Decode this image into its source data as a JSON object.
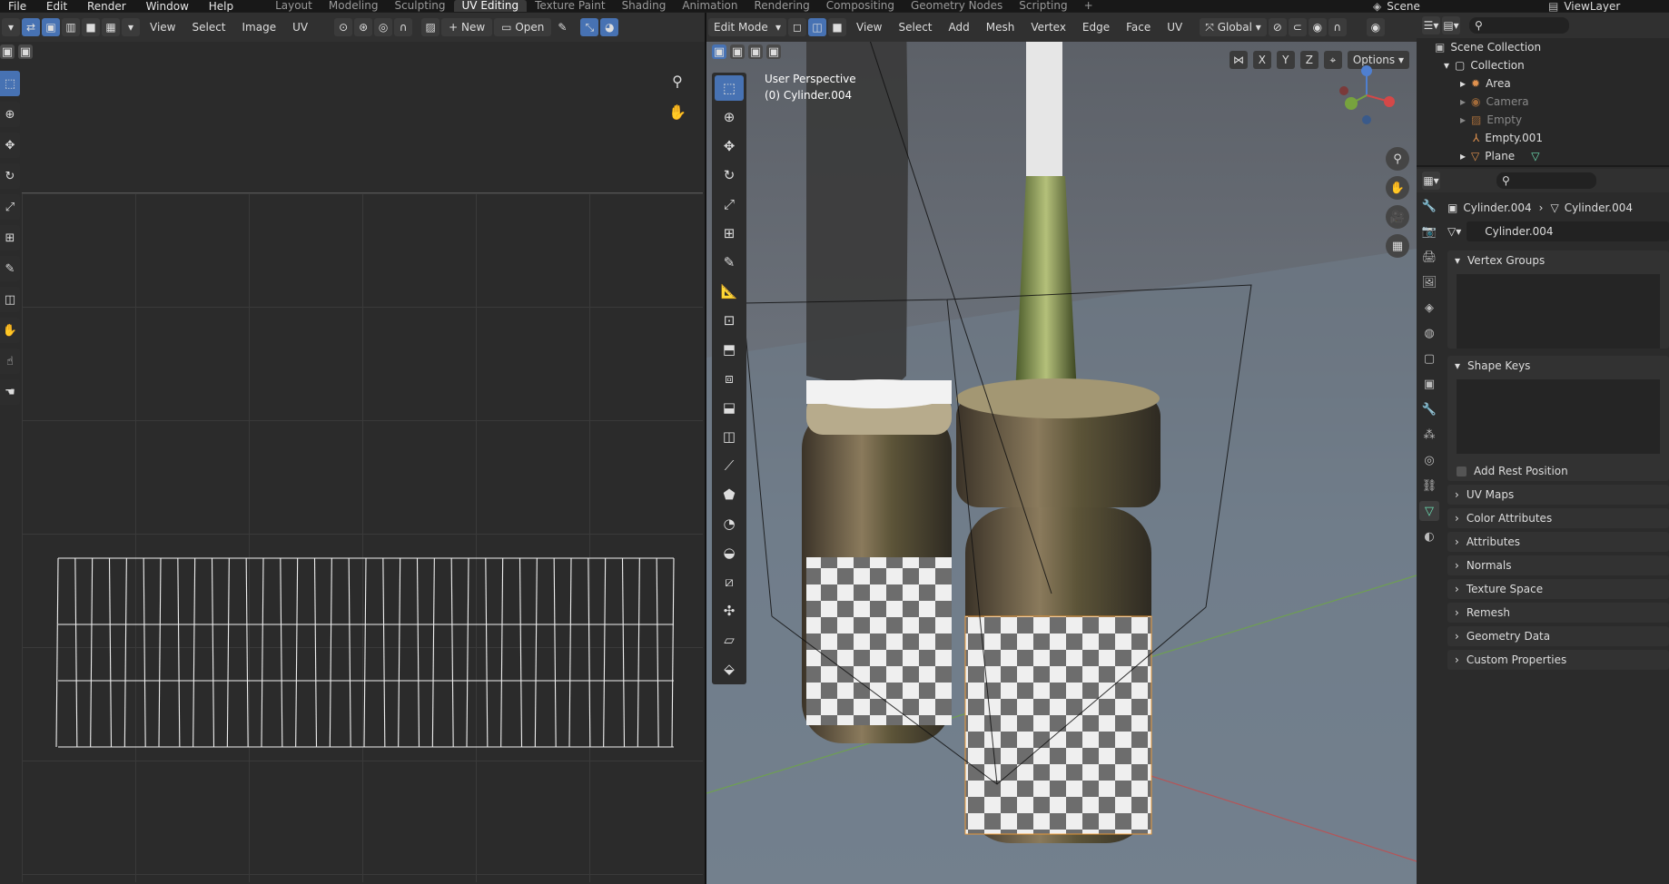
{
  "menu": [
    "File",
    "Edit",
    "Render",
    "Window",
    "Help"
  ],
  "workspaces": [
    "Layout",
    "Modeling",
    "Sculpting",
    "UV Editing",
    "Texture Paint",
    "Shading",
    "Animation",
    "Rendering",
    "Compositing",
    "Geometry Nodes",
    "Scripting",
    "+"
  ],
  "active_workspace_index": 3,
  "scene_name": "Scene",
  "view_layer": "ViewLayer",
  "uv_header": {
    "view": "View",
    "select": "Select",
    "image": "Image",
    "uv": "UV",
    "new": "New",
    "open": "Open"
  },
  "vp_header": {
    "mode": "Edit Mode",
    "view": "View",
    "select": "Select",
    "add": "Add",
    "mesh": "Mesh",
    "vertex": "Vertex",
    "edge": "Edge",
    "face": "Face",
    "uv": "UV",
    "orientation": "Global",
    "options": "Options",
    "x": "X",
    "y": "Y",
    "z": "Z"
  },
  "viewport_info": {
    "line1": "User Perspective",
    "line2": "(0) Cylinder.004"
  },
  "outliner": {
    "scene_collection": "Scene Collection",
    "collection": "Collection",
    "items": [
      {
        "name": "Area",
        "dim": false
      },
      {
        "name": "Camera",
        "dim": true
      },
      {
        "name": "Empty",
        "dim": true
      },
      {
        "name": "Empty.001",
        "dim": false
      },
      {
        "name": "Plane",
        "dim": false
      }
    ]
  },
  "properties": {
    "breadcrumb_object": "Cylinder.004",
    "breadcrumb_mesh": "Cylinder.004",
    "mesh_name": "Cylinder.004",
    "panels": [
      "Vertex Groups",
      "Shape Keys"
    ],
    "add_rest_position": "Add Rest Position",
    "collapsed": [
      "UV Maps",
      "Color Attributes",
      "Attributes",
      "Normals",
      "Texture Space",
      "Remesh",
      "Geometry Data",
      "Custom Properties"
    ]
  },
  "colors": {
    "accent": "#4772b3",
    "selection": "#f39c33",
    "mesh_green": "#6de1b5"
  }
}
